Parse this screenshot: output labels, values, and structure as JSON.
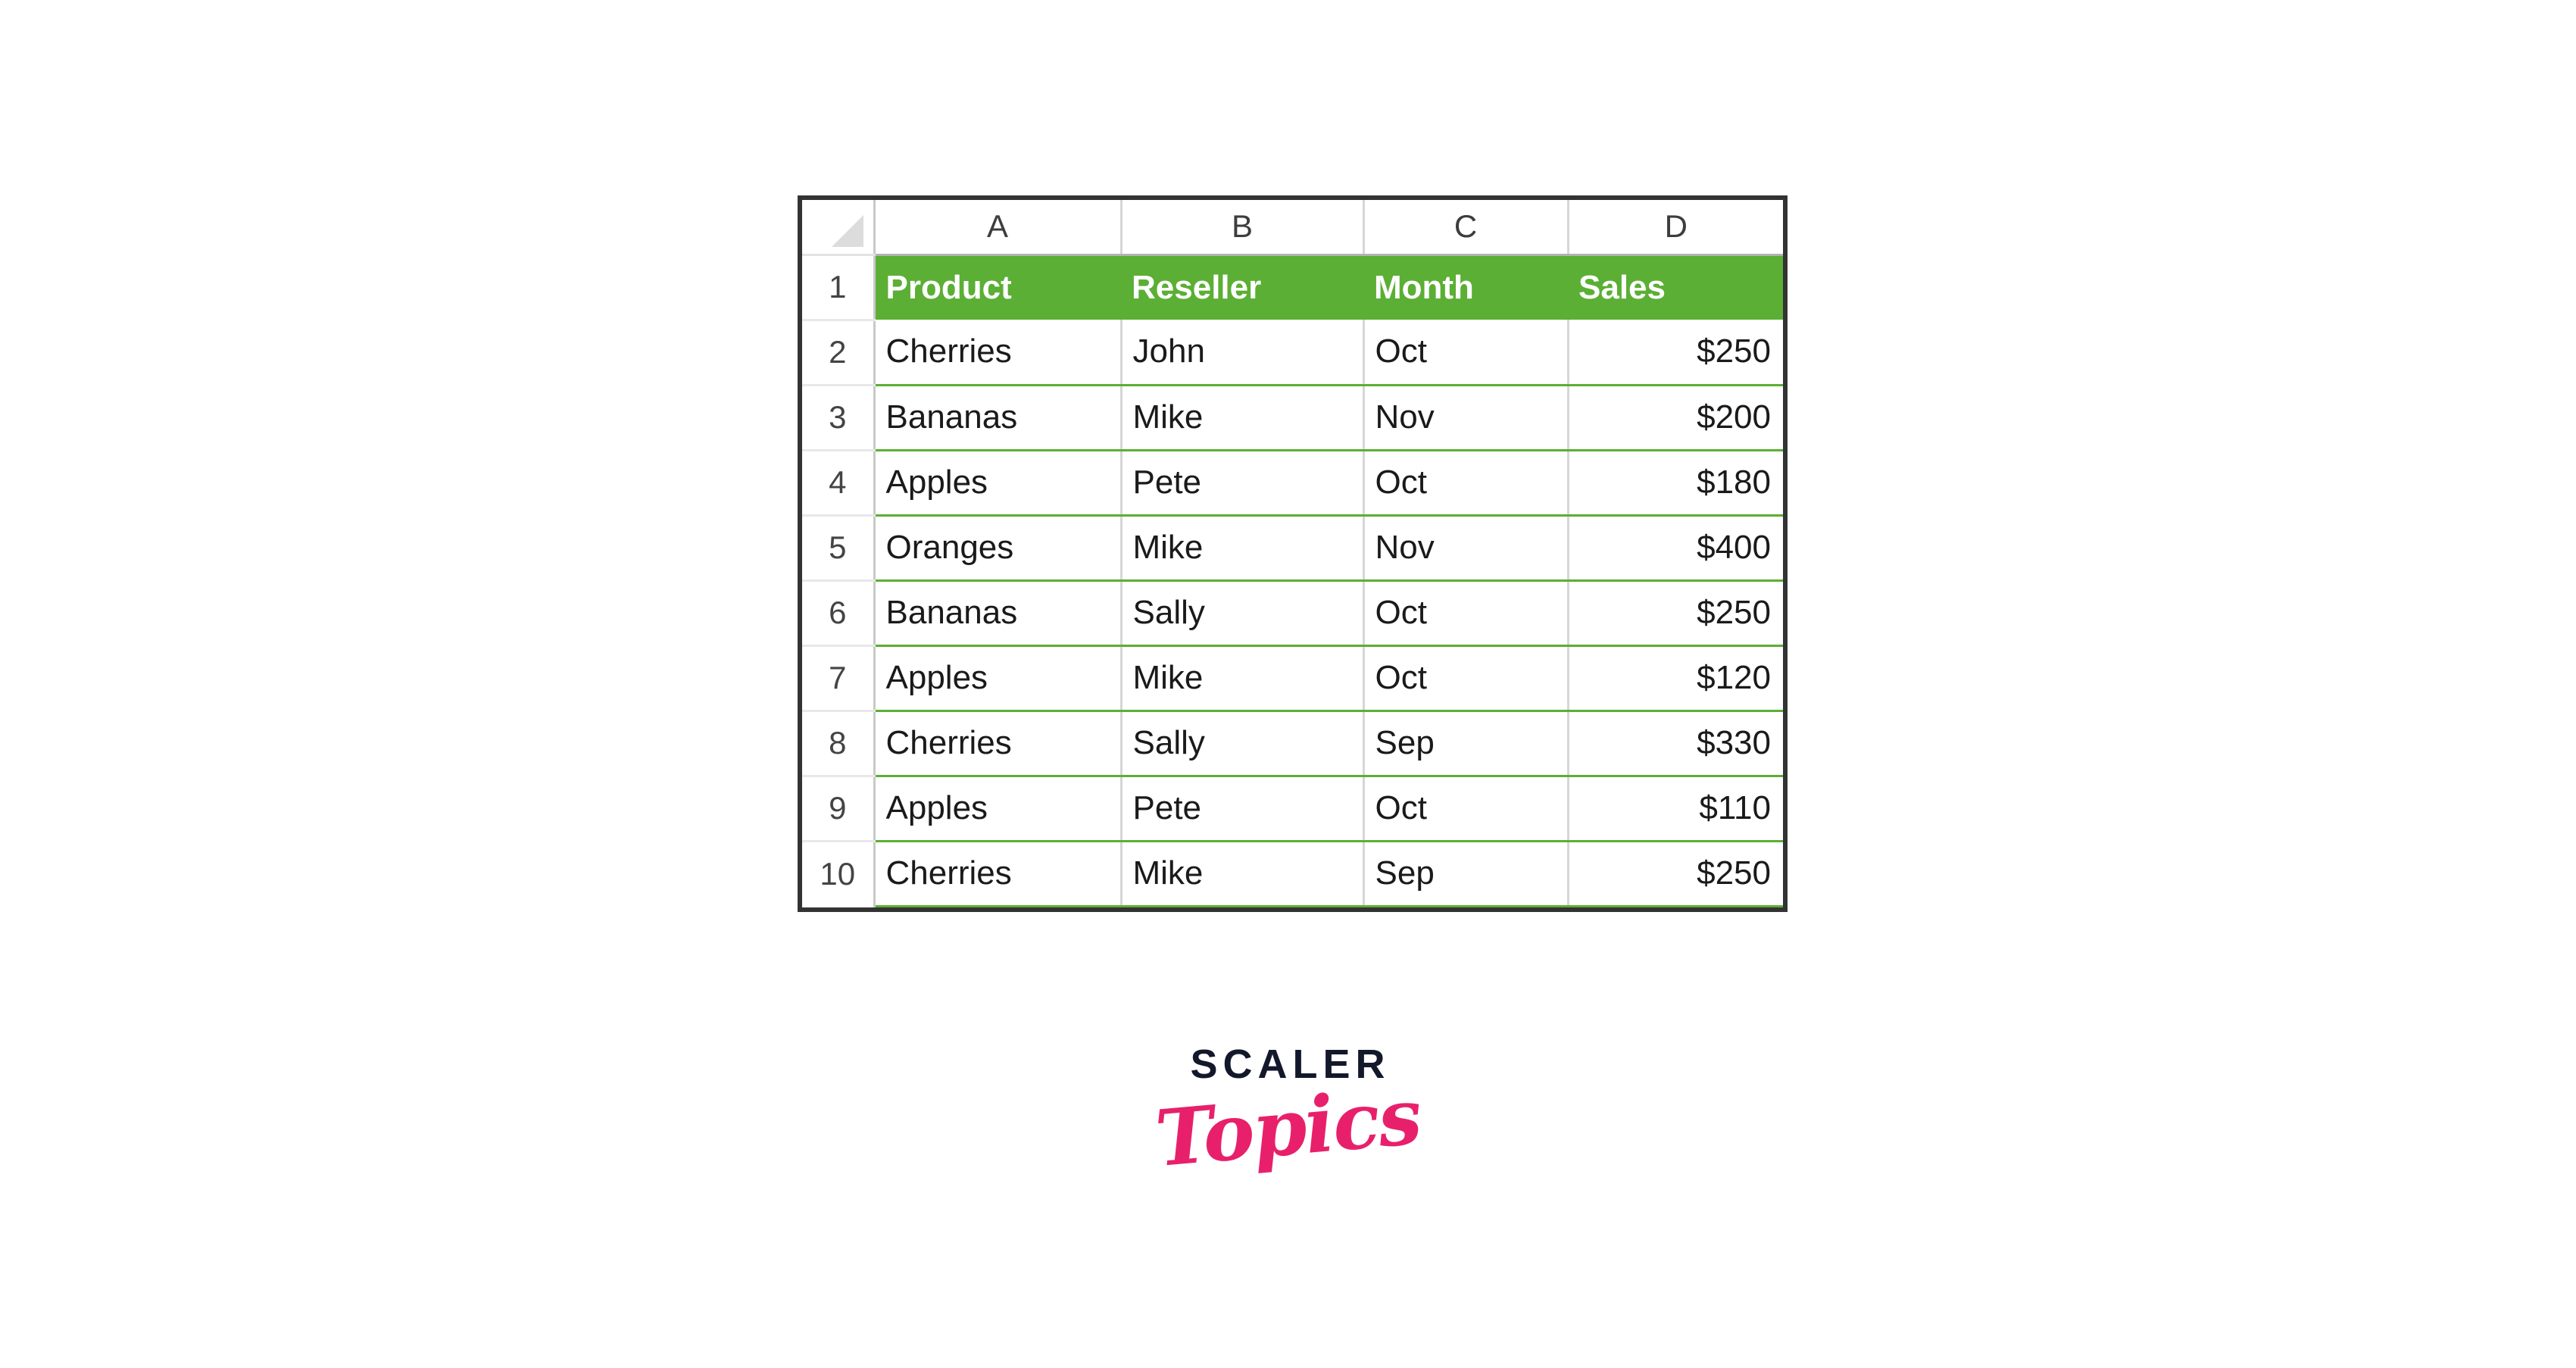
{
  "spreadsheet": {
    "corner_icon": "select-all-triangle-icon",
    "column_letters": [
      "A",
      "B",
      "C",
      "D"
    ],
    "row_numbers": [
      "1",
      "2",
      "3",
      "4",
      "5",
      "6",
      "7",
      "8",
      "9",
      "10"
    ],
    "header_row_number": "1",
    "headers": [
      "Product",
      "Reseller",
      "Month",
      "Sales"
    ],
    "header_fill_color": "#5BAF34",
    "header_text_color": "#FFFFFF",
    "row_separator_color": "#5BAF34",
    "outer_border_color": "#333333",
    "rows": [
      {
        "row": "2",
        "product": "Cherries",
        "reseller": "John",
        "month": "Oct",
        "sales": "$250"
      },
      {
        "row": "3",
        "product": "Bananas",
        "reseller": "Mike",
        "month": "Nov",
        "sales": "$200"
      },
      {
        "row": "4",
        "product": "Apples",
        "reseller": "Pete",
        "month": "Oct",
        "sales": "$180"
      },
      {
        "row": "5",
        "product": "Oranges",
        "reseller": "Mike",
        "month": "Nov",
        "sales": "$400"
      },
      {
        "row": "6",
        "product": "Bananas",
        "reseller": "Sally",
        "month": "Oct",
        "sales": "$250"
      },
      {
        "row": "7",
        "product": "Apples",
        "reseller": "Mike",
        "month": "Oct",
        "sales": "$120"
      },
      {
        "row": "8",
        "product": "Cherries",
        "reseller": "Sally",
        "month": "Sep",
        "sales": "$330"
      },
      {
        "row": "9",
        "product": "Apples",
        "reseller": "Pete",
        "month": "Oct",
        "sales": "$110"
      },
      {
        "row": "10",
        "product": "Cherries",
        "reseller": "Mike",
        "month": "Sep",
        "sales": "$250"
      }
    ]
  },
  "logo": {
    "primary": "SCALER",
    "secondary": "Topics",
    "primary_color": "#13182B",
    "secondary_color": "#E8206C"
  }
}
